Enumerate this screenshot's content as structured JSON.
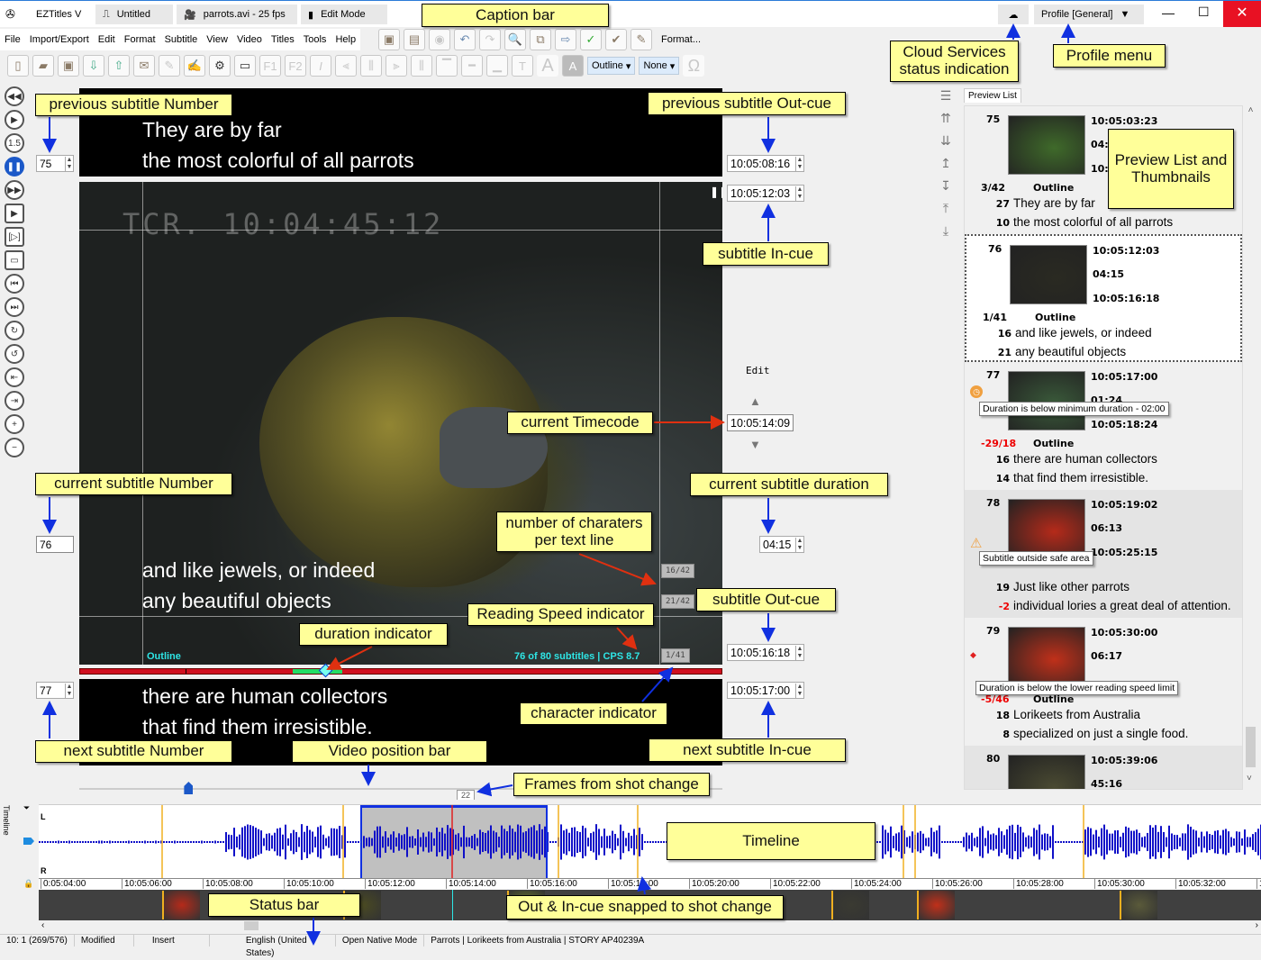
{
  "titlebar": {
    "app": "EZTitles V",
    "document": "Untitled",
    "video": "parrots.avi - 25 fps",
    "mode": "Edit Mode",
    "profile": "Profile [General]"
  },
  "menu": [
    "File",
    "Import/Export",
    "Edit",
    "Format",
    "Subtitle",
    "View",
    "Video",
    "Titles",
    "Tools",
    "Help"
  ],
  "toolbar": {
    "format_label": "Format...",
    "style_select": "Outline",
    "box_select": "None"
  },
  "subtitles": {
    "previous": {
      "number": "75",
      "lines": [
        "They are by far",
        "the most colorful of all parrots"
      ],
      "out_cue": "10:05:08:16"
    },
    "current": {
      "number": "76",
      "lines": [
        "and like jewels, or indeed",
        "any beautiful objects"
      ],
      "in_cue": "10:05:12:03",
      "out_cue": "10:05:16:18",
      "duration": "04:15",
      "style": "Outline",
      "status": "76 of 80 subtitles | CPS 8.7",
      "line_counts": [
        "16/42",
        "21/42"
      ],
      "char_indicator": "1/41"
    },
    "next": {
      "number": "77",
      "lines": [
        "there are human collectors",
        "that find them irresistible."
      ],
      "in_cue": "10:05:17:00"
    }
  },
  "video": {
    "tcr": "TCR. 10:04:45:12",
    "current_timecode": "10:05:14:09",
    "edit_label": "Edit",
    "frames_from_shot_change": "22",
    "position": 0.17
  },
  "preview": {
    "tab": "Preview List",
    "items": [
      {
        "num": "75",
        "tc_in": "10:05:03:23",
        "dur": "04:",
        "tc_out": "10:",
        "cps": "3/42",
        "style": "Outline",
        "lines": [
          [
            "27",
            "They are by far"
          ],
          [
            "10",
            "the most colorful of all parrots"
          ]
        ]
      },
      {
        "num": "76",
        "tc_in": "10:05:12:03",
        "dur": "04:15",
        "tc_out": "10:05:16:18",
        "cps": "1/41",
        "style": "Outline",
        "lines": [
          [
            "16",
            "and like jewels, or indeed"
          ],
          [
            "21",
            "any beautiful objects"
          ]
        ]
      },
      {
        "num": "77",
        "tc_in": "10:05:17:00",
        "dur": "01:24",
        "tc_out": "10:05:18:24",
        "cps": "-29/18",
        "style": "Outline",
        "lines": [
          [
            "16",
            "there are human collectors"
          ],
          [
            "14",
            "that find them irresistible."
          ]
        ],
        "tip": "Duration is below minimum duration - 02:00"
      },
      {
        "num": "78",
        "tc_in": "10:05:19:02",
        "dur": "06:13",
        "tc_out": "10:05:25:15",
        "cps": "",
        "style": "",
        "lines": [
          [
            "19",
            "Just like other parrots"
          ],
          [
            "-2",
            "individual lories a great deal of attention."
          ]
        ],
        "tip": "Subtitle outside safe area"
      },
      {
        "num": "79",
        "tc_in": "10:05:30:00",
        "dur": "06:17",
        "tc_out": "",
        "cps": "-5/46",
        "style": "Outline",
        "lines": [
          [
            "18",
            "Lorikeets from Australia"
          ],
          [
            "8",
            "specialized on just a single food."
          ]
        ],
        "tip": "Duration is below the lower reading speed limit"
      },
      {
        "num": "80",
        "tc_in": "10:05:39:06",
        "dur": "45:16",
        "tc_out": "",
        "cps": "",
        "style": "",
        "lines": []
      }
    ]
  },
  "timeline": {
    "label": "Timeline",
    "channel_l": "L",
    "channel_r": "R",
    "ticks": [
      "0:05:04:00",
      "10:05:06:00",
      "10:05:08:00",
      "10:05:10:00",
      "10:05:12:00",
      "10:05:14:00",
      "10:05:16:00",
      "10:05:18:00",
      "10:05:20:00",
      "10:05:22:00",
      "10:05:24:00",
      "10:05:26:00",
      "10:05:28:00",
      "10:05:30:00",
      "10:05:32:00",
      "10:0"
    ]
  },
  "statusbar": [
    "10: 1 (269/576)",
    "Modified",
    "Insert",
    "English (United States)",
    "Open Native Mode",
    "Parrots | Lorikeets from Australia | STORY AP40239A"
  ],
  "annotations": {
    "caption_bar": "Caption bar",
    "cloud": "Cloud Services status indication",
    "profile": "Profile menu",
    "preview": "Preview List and Thumbnails",
    "prev_num": "previous subtitle Number",
    "prev_out": "previous subtitle Out-cue",
    "in_cue": "subtitle In-cue",
    "cur_tc": "current Timecode",
    "cur_num": "current subtitle Number",
    "cur_dur": "current subtitle duration",
    "chars_line": "number of charaters per text line",
    "out_cue": "subtitle Out-cue",
    "reading_speed": "Reading Speed indicator",
    "duration_ind": "duration indicator",
    "char_ind": "character indicator",
    "next_num": "next subtitle Number",
    "video_pos": "Video position bar",
    "next_in": "next subtitle In-cue",
    "frames_shot": "Frames from shot change",
    "timeline": "Timeline",
    "status_bar": "Status bar",
    "snapped": "Out & In-cue snapped to shot change"
  },
  "colors": {
    "annotation": "#ffff99",
    "accent": "#1b58c8",
    "close": "#e81123",
    "overlay_text": "#2ee6e6"
  }
}
